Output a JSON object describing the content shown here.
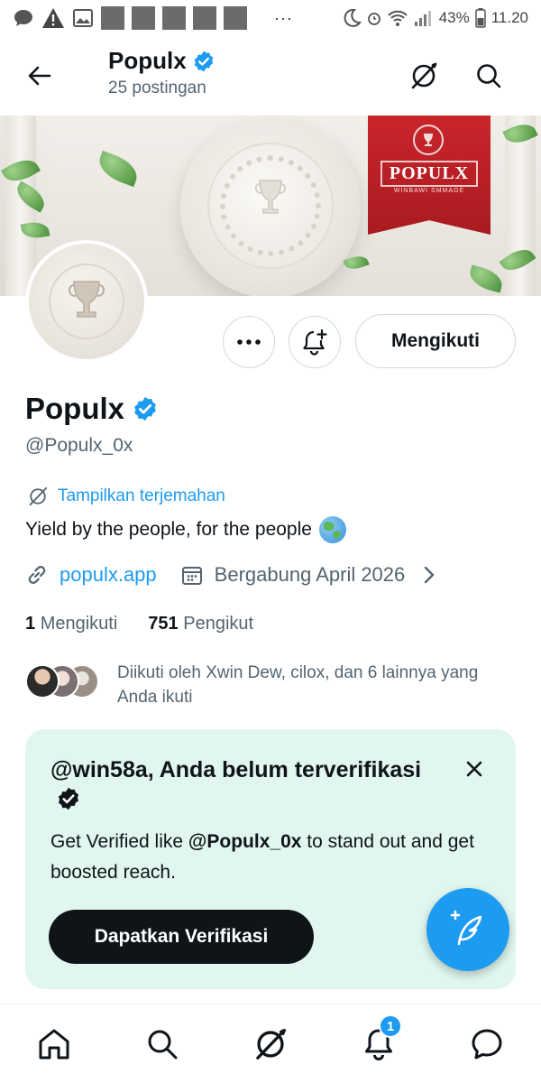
{
  "status_bar": {
    "battery": "43%",
    "time": "11.20",
    "dots": "···"
  },
  "header": {
    "title": "Populx",
    "subtitle": "25 postingan"
  },
  "banner": {
    "brand_text": "POPULX",
    "brand_sub": "WINBAWI SMMAOE",
    "brand_color": "#c9252b"
  },
  "actions": {
    "follow_label": "Mengikuti"
  },
  "profile": {
    "name": "Populx",
    "handle": "@Populx_0x",
    "translate_label": "Tampilkan terjemahan",
    "bio": "Yield by the people, for the people",
    "website": "populx.app",
    "joined": "Bergabung April 2026",
    "following_count": "1",
    "following_label": "Mengikuti",
    "followers_count": "751",
    "followers_label": "Pengikut",
    "followed_by": "Diikuti oleh Xwin Dew, cilox, dan 6 lainnya yang Anda ikuti"
  },
  "verify_card": {
    "title": "@win58a, Anda belum terverifikasi",
    "body_prefix": "Get Verified like ",
    "body_handle": "@Populx_0x",
    "body_suffix": " to stand out and get boosted reach.",
    "button_label": "Dapatkan Verifikasi",
    "background": "#e0f6ee"
  },
  "bottom_nav": {
    "notification_count": "1"
  },
  "colors": {
    "accent": "#1d9bf0",
    "text": "#0f1419",
    "secondary": "#536471"
  }
}
